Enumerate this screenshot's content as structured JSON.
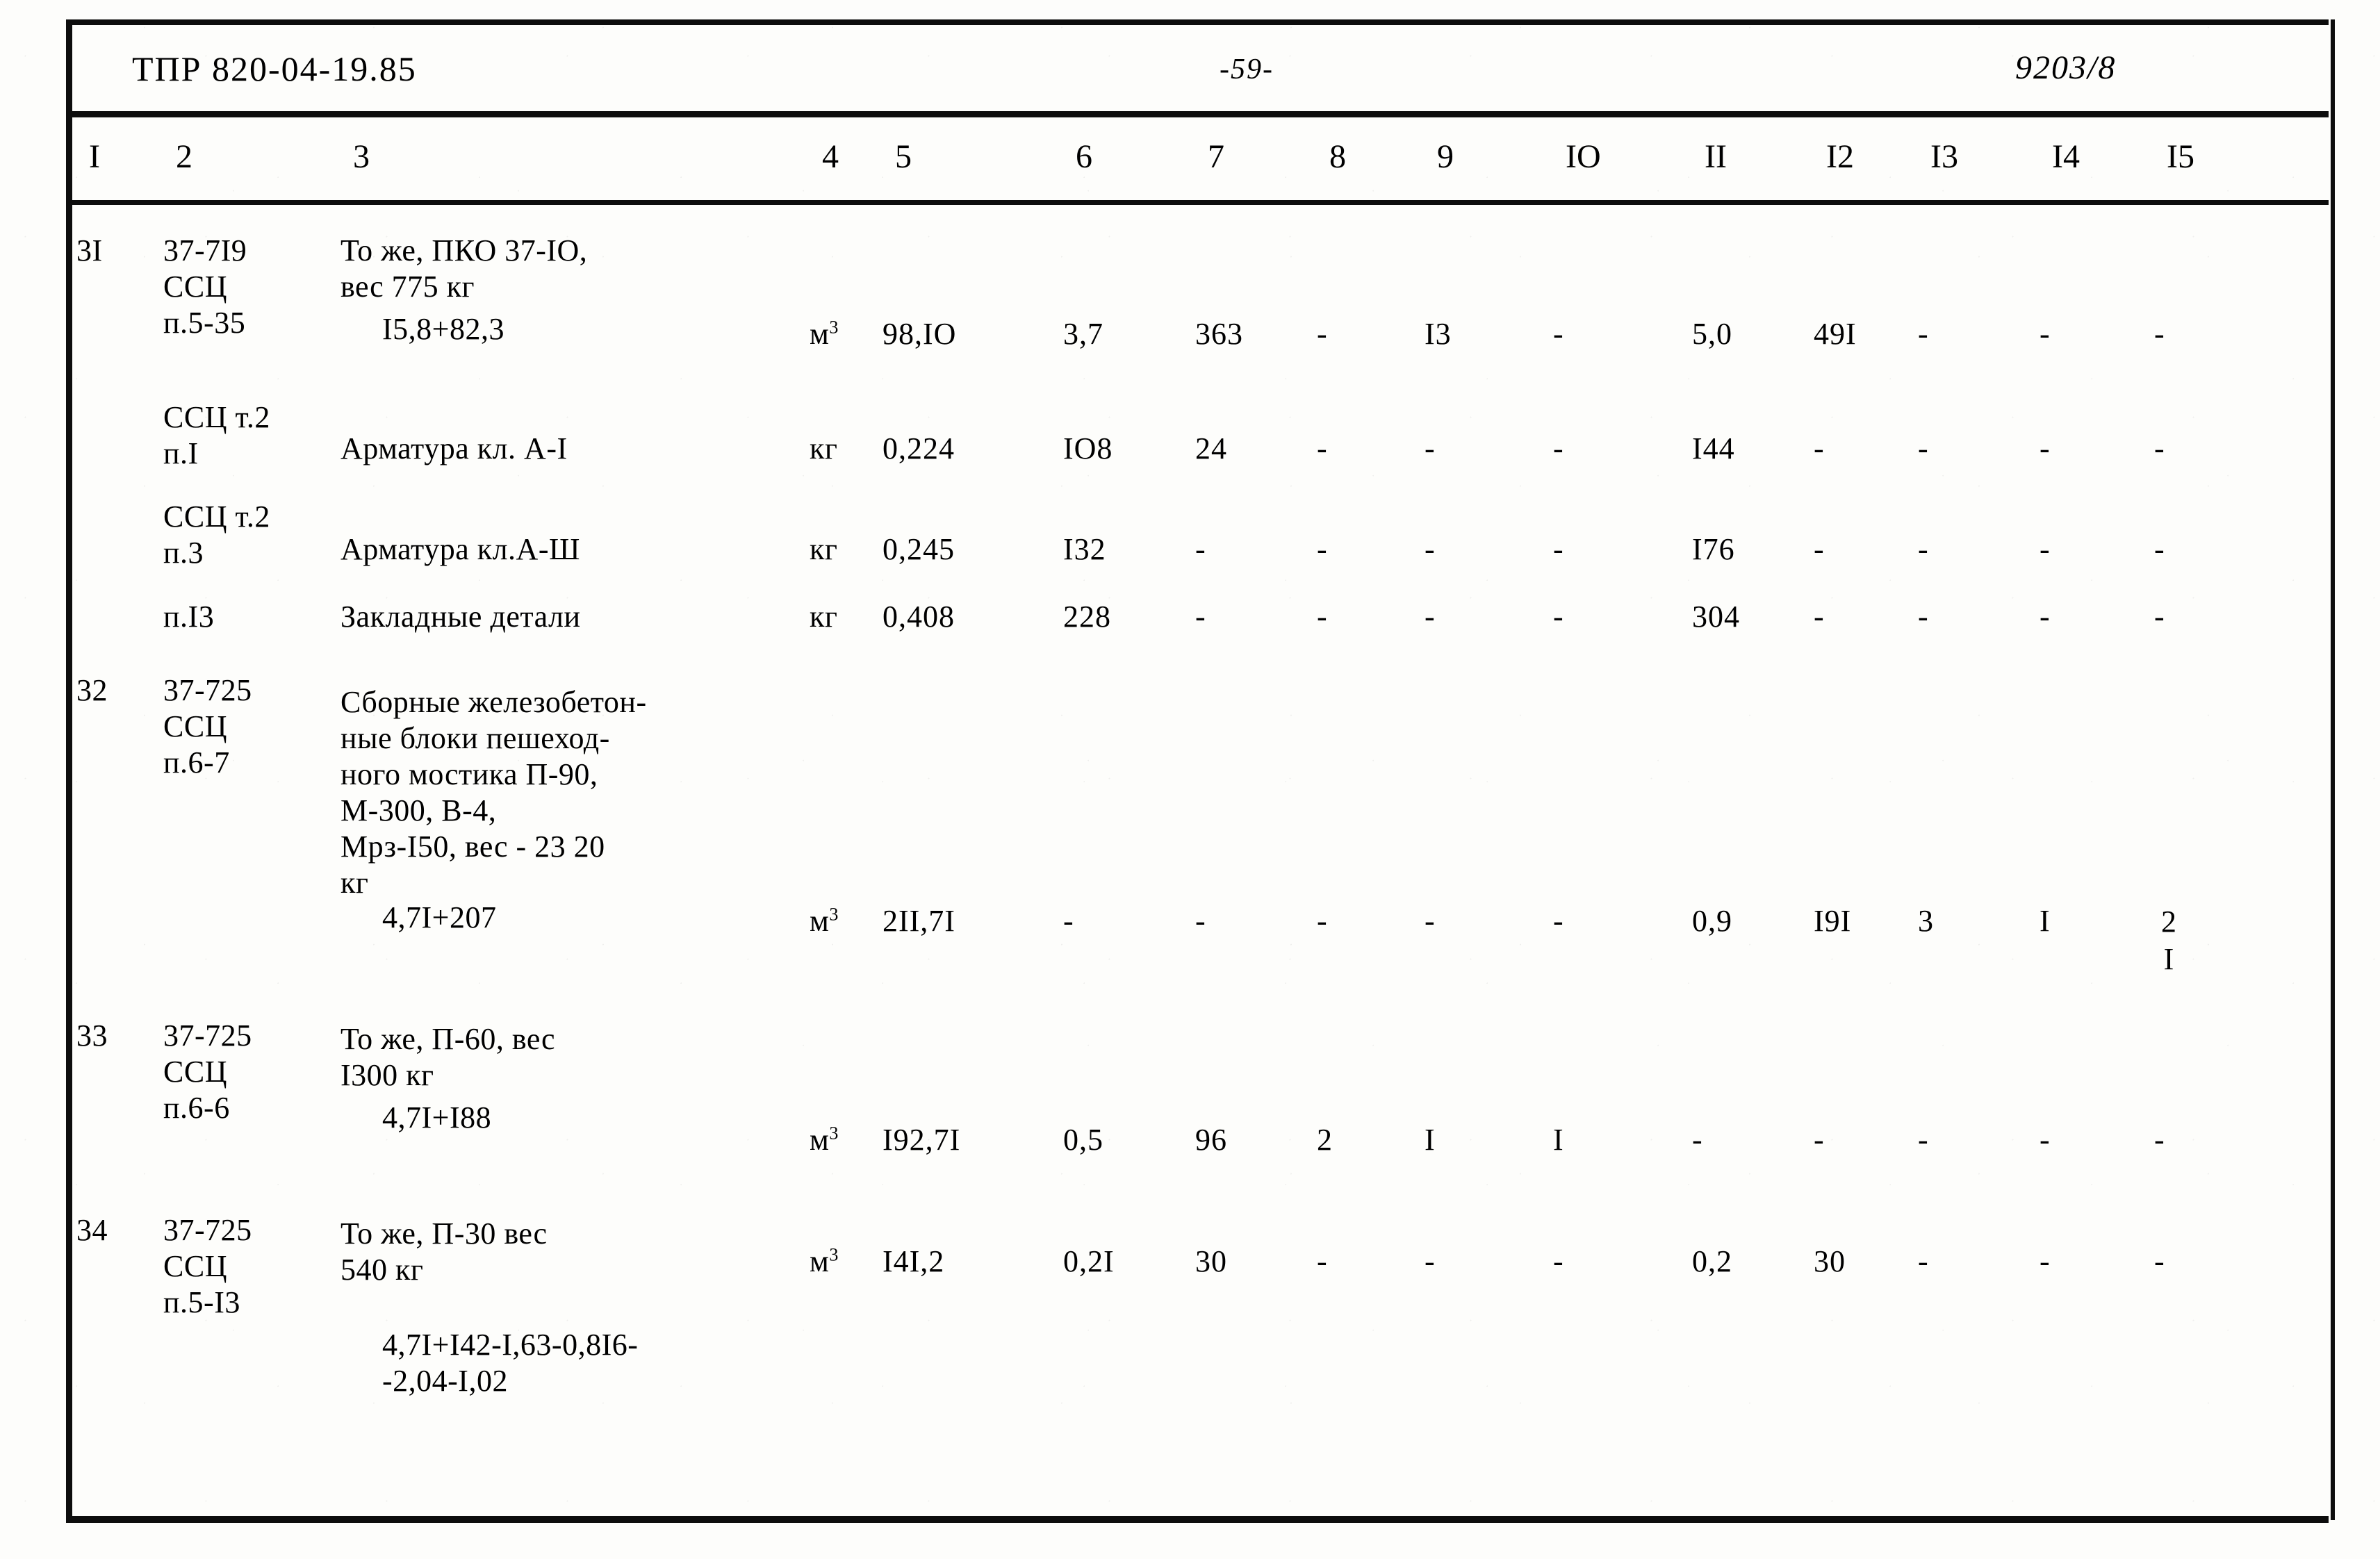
{
  "document": {
    "header_code": "ТПР 820-04-19.85",
    "page_number": "-59-",
    "sheet_code": "9203/8"
  },
  "table": {
    "column_numbers": [
      "I",
      "2",
      "3",
      "4",
      "5",
      "6",
      "7",
      "8",
      "9",
      "IO",
      "II",
      "I2",
      "I3",
      "I4",
      "I5"
    ],
    "rows": [
      {
        "no": "3I",
        "code": "37-7I9\nССЦ\nп.5-35",
        "description": "То же, ПКО 37-IO,\nвес 775 кг",
        "formula": "I5,8+82,3",
        "unit": "м",
        "unit_sup": "3",
        "c5": "98,IO",
        "c6": "3,7",
        "c7": "363",
        "c8": "-",
        "c9": "I3",
        "c10": "-",
        "c11": "5,0",
        "c12": "49I",
        "c13": "-",
        "c14": "-",
        "c15": "-"
      },
      {
        "no": "",
        "code": "ССЦ т.2\nп.I",
        "description": "Арматура кл. А-I",
        "formula": "",
        "unit": "кг",
        "unit_sup": "",
        "c5": "0,224",
        "c6": "IO8",
        "c7": "24",
        "c8": "-",
        "c9": "-",
        "c10": "-",
        "c11": "I44",
        "c12": "-",
        "c13": "-",
        "c14": "-",
        "c15": "-"
      },
      {
        "no": "",
        "code": "ССЦ т.2\nп.3",
        "description": "Арматура кл.А-Ш",
        "formula": "",
        "unit": "кг",
        "unit_sup": "",
        "c5": "0,245",
        "c6": "I32",
        "c7": "-",
        "c8": "-",
        "c9": "-",
        "c10": "-",
        "c11": "I76",
        "c12": "-",
        "c13": "-",
        "c14": "-",
        "c15": "-"
      },
      {
        "no": "",
        "code": "п.I3",
        "description": "Закладные детали",
        "formula": "",
        "unit": "кг",
        "unit_sup": "",
        "c5": "0,408",
        "c6": "228",
        "c7": "-",
        "c8": "-",
        "c9": "-",
        "c10": "-",
        "c11": "304",
        "c12": "-",
        "c13": "-",
        "c14": "-",
        "c15": "-"
      },
      {
        "no": "32",
        "code": "37-725\nССЦ\nп.6-7",
        "description": "Сборные железобетон-\nные блоки пешеход-\nного мостика П-90,\nМ-300, В-4,\nМрз-I50, вес - 23 20\nкг",
        "formula": "4,7I+207",
        "unit": "м",
        "unit_sup": "3",
        "c5": "2II,7I",
        "c6": "-",
        "c7": "-",
        "c8": "-",
        "c9": "-",
        "c10": "-",
        "c11": "0,9",
        "c12": "I9I",
        "c13": "3",
        "c14": "I",
        "c15": "2\nI"
      },
      {
        "no": "33",
        "code": "37-725\nССЦ\nп.6-6",
        "description": "То же, П-60, вес\nI300 кг",
        "formula": "4,7I+I88",
        "unit": "м",
        "unit_sup": "3",
        "c5": "I92,7I",
        "c6": "0,5",
        "c7": "96",
        "c8": "2",
        "c9": "I",
        "c10": "I",
        "c11": "-",
        "c12": "-",
        "c13": "-",
        "c14": "-",
        "c15": "-"
      },
      {
        "no": "34",
        "code": "37-725\nССЦ\nп.5-I3",
        "description": "То же, П-30 вес\n540 кг",
        "formula": "4,7I+I42-I,63-0,8I6-\n-2,04-I,02",
        "unit": "м",
        "unit_sup": "3",
        "c5": "I4I,2",
        "c6": "0,2I",
        "c7": "30",
        "c8": "-",
        "c9": "-",
        "c10": "-",
        "c11": "0,2",
        "c12": "30",
        "c13": "-",
        "c14": "-",
        "c15": "-"
      }
    ]
  }
}
